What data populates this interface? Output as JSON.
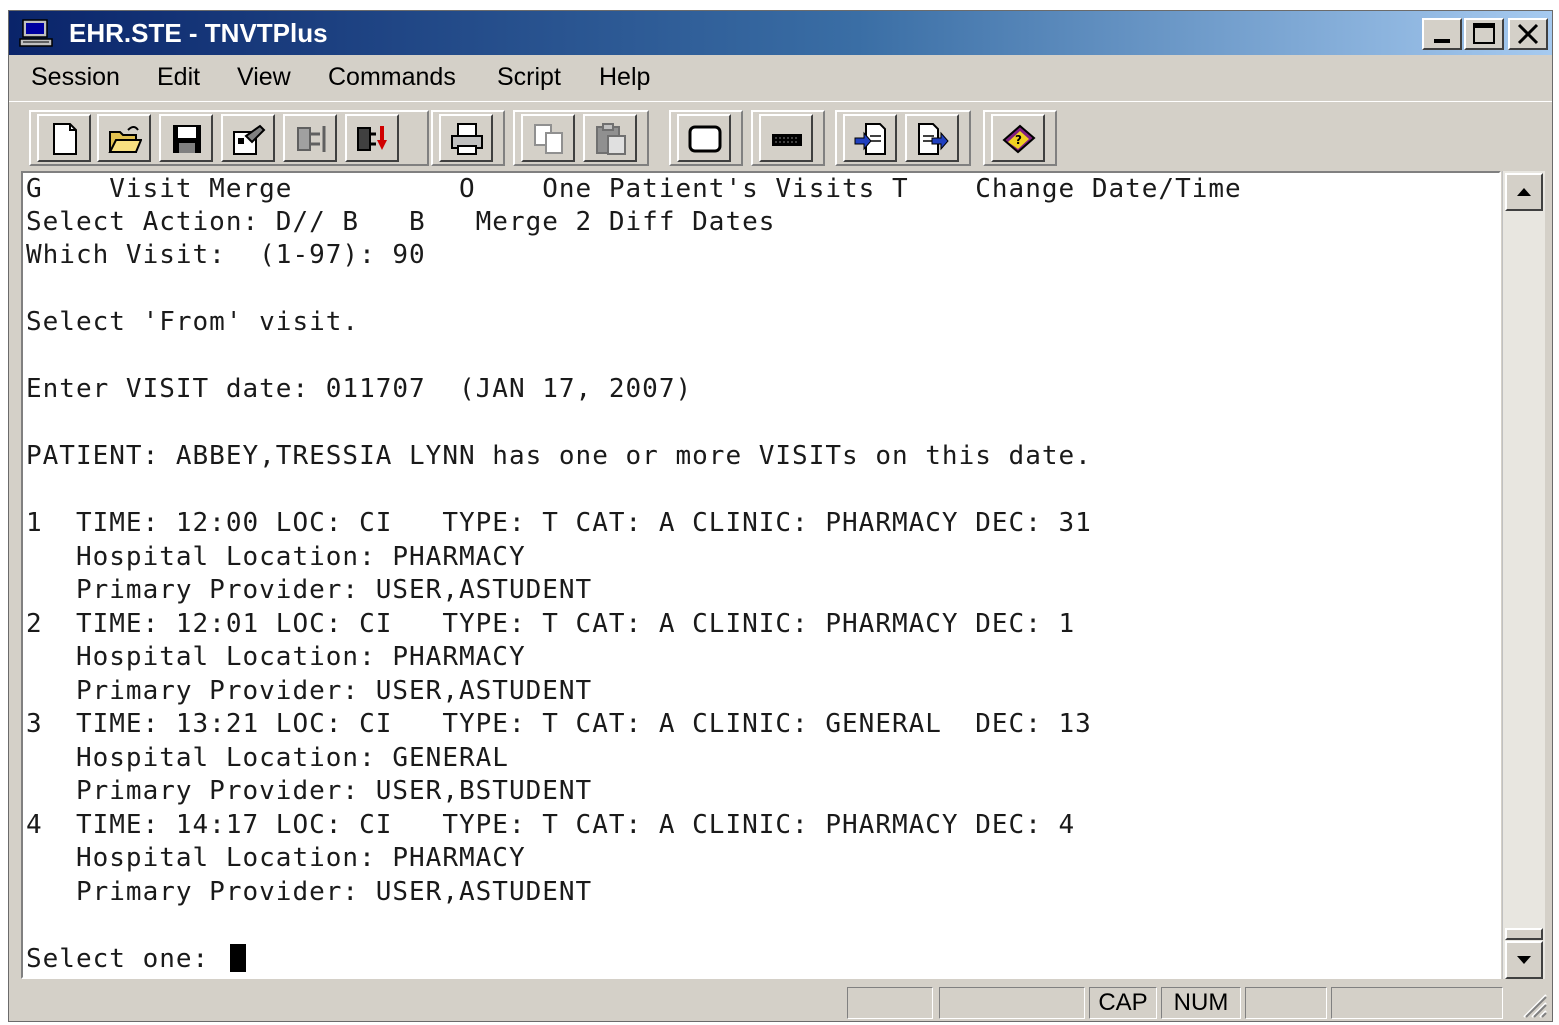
{
  "window": {
    "title": "EHR.STE - TNVTPlus",
    "controls": {
      "minimize": "_",
      "maximize": "□",
      "close": "×"
    }
  },
  "menu": [
    "Session",
    "Edit",
    "View",
    "Commands",
    "Script",
    "Help"
  ],
  "toolbar": {
    "icons": [
      "new-icon",
      "open-icon",
      "save-icon",
      "properties-icon",
      "connect-icon",
      "disconnect-icon",
      "print-icon",
      "copy-icon",
      "paste-icon",
      "screen-icon",
      "keyboard-icon",
      "send-file-icon",
      "receive-file-icon",
      "help-book-icon"
    ]
  },
  "terminal": {
    "lines": [
      "G    Visit Merge          O    One Patient's Visits T    Change Date/Time",
      "Select Action: D// B   B   Merge 2 Diff Dates",
      "Which Visit:  (1-97): 90",
      "",
      "Select 'From' visit.",
      "",
      "Enter VISIT date: 011707  (JAN 17, 2007)",
      "",
      "PATIENT: ABBEY,TRESSIA LYNN has one or more VISITs on this date.",
      "",
      "1  TIME: 12:00 LOC: CI   TYPE: T CAT: A CLINIC: PHARMACY DEC: 31",
      "   Hospital Location: PHARMACY",
      "   Primary Provider: USER,ASTUDENT",
      "2  TIME: 12:01 LOC: CI   TYPE: T CAT: A CLINIC: PHARMACY DEC: 1",
      "   Hospital Location: PHARMACY",
      "   Primary Provider: USER,ASTUDENT",
      "3  TIME: 13:21 LOC: CI   TYPE: T CAT: A CLINIC: GENERAL  DEC: 13",
      "   Hospital Location: GENERAL",
      "   Primary Provider: USER,BSTUDENT",
      "4  TIME: 14:17 LOC: CI   TYPE: T CAT: A CLINIC: PHARMACY DEC: 4",
      "   Hospital Location: PHARMACY",
      "   Primary Provider: USER,ASTUDENT",
      ""
    ],
    "prompt": "Select one: "
  },
  "status": {
    "cap": "CAP",
    "num": "NUM"
  }
}
